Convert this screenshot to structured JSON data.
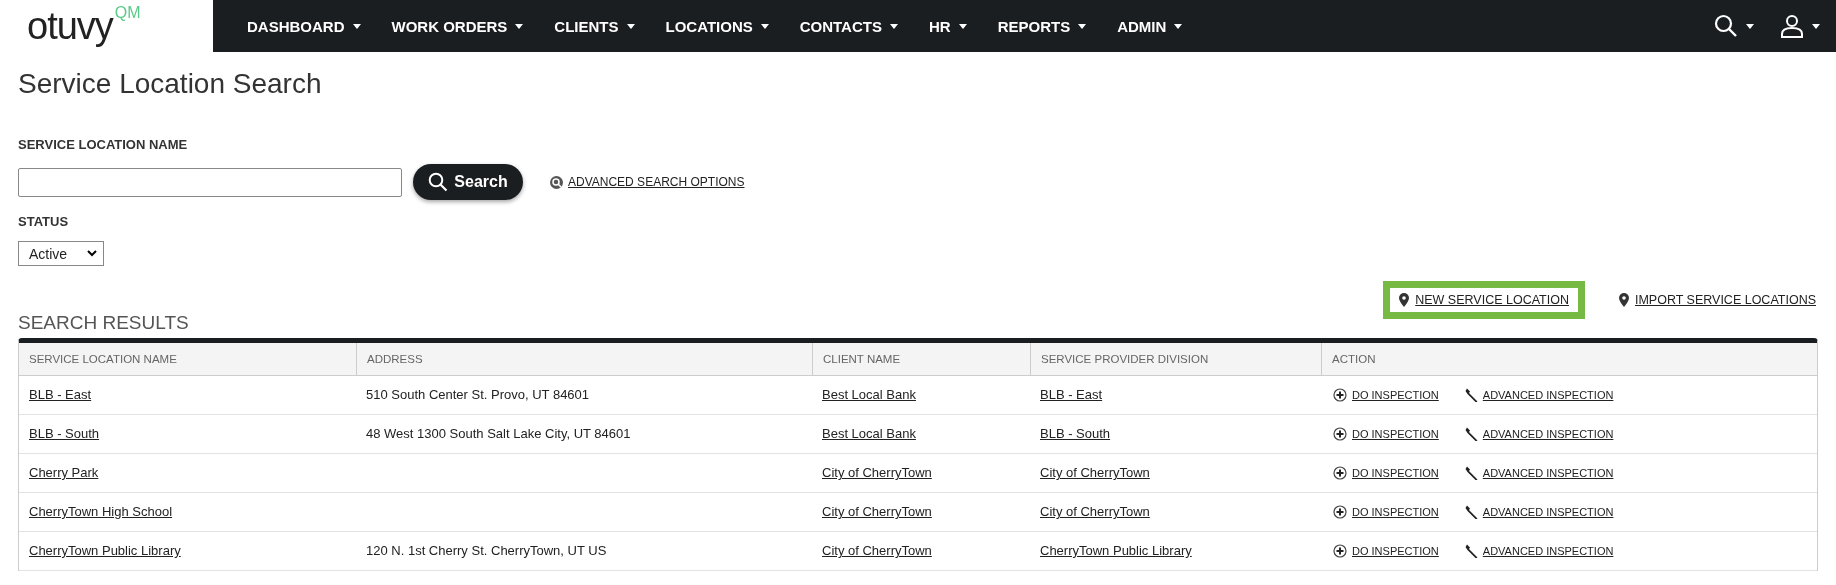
{
  "logo": {
    "name": "otuvy",
    "mark": "QM"
  },
  "nav": {
    "items": [
      {
        "label": "DASHBOARD"
      },
      {
        "label": "WORK ORDERS"
      },
      {
        "label": "CLIENTS"
      },
      {
        "label": "LOCATIONS"
      },
      {
        "label": "CONTACTS"
      },
      {
        "label": "HR"
      },
      {
        "label": "REPORTS"
      },
      {
        "label": "ADMIN"
      }
    ]
  },
  "page_title": "Service Location Search",
  "search_form": {
    "name_label": "SERVICE LOCATION NAME",
    "search_button": "Search",
    "advanced_link": "ADVANCED SEARCH OPTIONS",
    "status_label": "STATUS",
    "status_value": "Active"
  },
  "actions": [
    {
      "label": "NEW SERVICE LOCATION",
      "highlighted": true
    },
    {
      "label": "IMPORT SERVICE LOCATIONS",
      "highlighted": false
    }
  ],
  "results": {
    "title": "SEARCH RESULTS",
    "columns": [
      "SERVICE LOCATION NAME",
      "ADDRESS",
      "CLIENT NAME",
      "SERVICE PROVIDER DIVISION",
      "ACTION"
    ],
    "rows": [
      {
        "name": "BLB - East",
        "address": "510 South Center St. Provo, UT 84601",
        "client": "Best Local Bank",
        "division": "BLB - East",
        "do": "DO INSPECTION",
        "advanced": "ADVANCED INSPECTION"
      },
      {
        "name": "BLB - South",
        "address": "48 West 1300 South Salt Lake City, UT 84601",
        "client": "Best Local Bank",
        "division": "BLB - South",
        "do": "DO INSPECTION",
        "advanced": "ADVANCED INSPECTION"
      },
      {
        "name": "Cherry Park",
        "client": "City of CherryTown",
        "division": "City of CherryTown",
        "do": "DO INSPECTION",
        "advanced": "ADVANCED INSPECTION"
      },
      {
        "name": "CherryTown High School",
        "client": "City of CherryTown",
        "division": "City of CherryTown",
        "do": "DO INSPECTION",
        "advanced": "ADVANCED INSPECTION"
      },
      {
        "name": "CherryTown Public Library",
        "address": "120 N. 1st Cherry St. CherryTown, UT US",
        "client": "City of CherryTown",
        "division": "CherryTown Public Library",
        "do": "DO INSPECTION",
        "advanced": "ADVANCED INSPECTION"
      }
    ]
  }
}
